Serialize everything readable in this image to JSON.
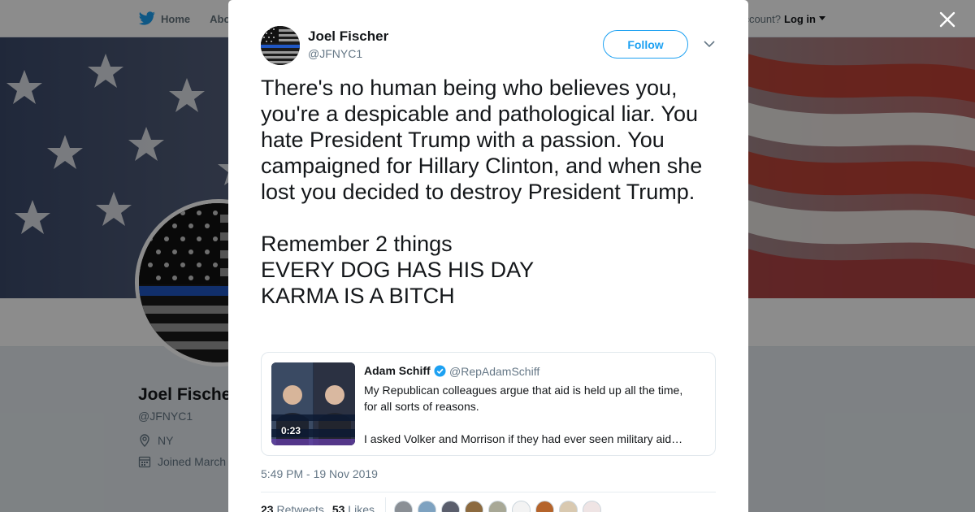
{
  "topbar": {
    "home_label": "Home",
    "about_label": "Abo",
    "account_prompt": "ccount?",
    "login_label": "Log in"
  },
  "profile": {
    "name": "Joel Fische",
    "handle": "@JFNYC1",
    "location": "NY",
    "joined": "Joined March"
  },
  "tweet": {
    "author_name": "Joel Fischer",
    "author_handle": "@JFNYC1",
    "follow_label": "Follow",
    "text_paragraphs": [
      "There's no human being who believes you, you're a despicable and pathological liar. You hate President Trump with a passion. You campaigned for Hillary Clinton, and when she lost you decided to destroy President Trump."
    ],
    "text_lines": [
      "Remember 2 things",
      "EVERY DOG HAS HIS DAY",
      "KARMA IS A BITCH"
    ],
    "timestamp": "5:49 PM - 19 Nov 2019",
    "retweets_count": "23",
    "retweets_label": "Retweets",
    "likes_count": "53",
    "likes_label": "Likes"
  },
  "quoted_tweet": {
    "author_name": "Adam Schiff",
    "author_handle": "@RepAdamSchiff",
    "line1": "My Republican colleagues argue that aid is held up all the time,",
    "line2": "for all sorts of reasons.",
    "line3": "I asked Volker and Morrison if they had ever seen military aid…",
    "video_duration": "0:23"
  },
  "colors": {
    "brand_blue": "#1da1f2",
    "text_primary": "#14171a",
    "text_secondary": "#657786"
  }
}
